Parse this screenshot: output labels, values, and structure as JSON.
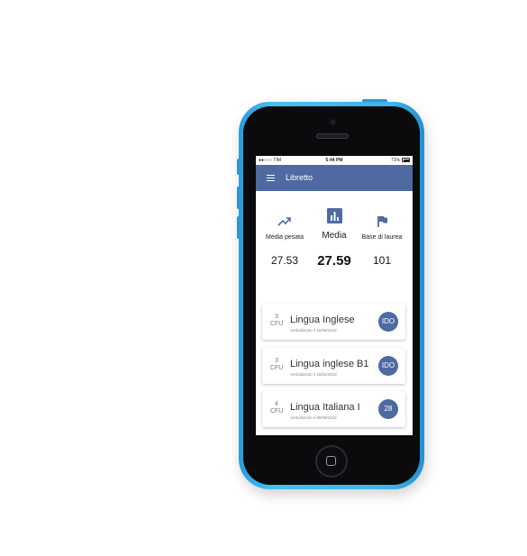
{
  "status_bar": {
    "carrier": "●●○○○ TIM",
    "time": "5:44 PM",
    "battery": "71%"
  },
  "app_bar": {
    "title": "Libretto",
    "menu_icon": "menu-icon"
  },
  "stats": [
    {
      "icon": "trending-up-icon",
      "label": "Media pesata",
      "value": "27.53"
    },
    {
      "icon": "bar-chart-icon",
      "label": "Media",
      "value": "27.59"
    },
    {
      "icon": "flag-icon",
      "label": "Base di laurea",
      "value": "101"
    }
  ],
  "exams": [
    {
      "cfu": "3",
      "cfu_label": "CFU",
      "name": "Lingua Inglese",
      "date": "Verbalizzato il 16/06/2018",
      "grade": "IDO"
    },
    {
      "cfu": "3",
      "cfu_label": "CFU",
      "name": "Lingua inglese B1",
      "date": "Verbalizzato il 18/02/2018",
      "grade": "IDO"
    },
    {
      "cfu": "4",
      "cfu_label": "CFU",
      "name": "Lingua Italiana I",
      "date": "Verbalizzato il 08/09/2018",
      "grade": "28"
    }
  ],
  "colors": {
    "accent": "#4e6aa0",
    "phone_shell": "#3fb4ea"
  }
}
